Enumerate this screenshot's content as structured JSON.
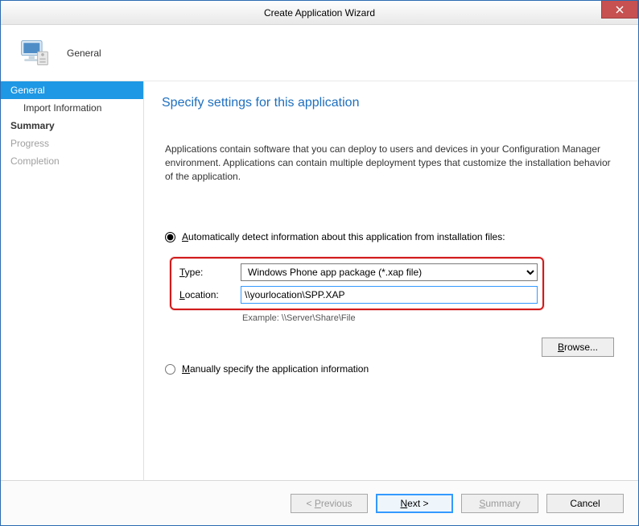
{
  "window": {
    "title": "Create Application Wizard"
  },
  "header": {
    "title": "General"
  },
  "sidebar": {
    "items": [
      {
        "label": "General",
        "selected": true,
        "bold": false,
        "sub": false,
        "disabled": false
      },
      {
        "label": "Import Information",
        "selected": false,
        "bold": false,
        "sub": true,
        "disabled": false
      },
      {
        "label": "Summary",
        "selected": false,
        "bold": true,
        "sub": false,
        "disabled": false
      },
      {
        "label": "Progress",
        "selected": false,
        "bold": false,
        "sub": false,
        "disabled": true
      },
      {
        "label": "Completion",
        "selected": false,
        "bold": false,
        "sub": false,
        "disabled": true
      }
    ]
  },
  "main": {
    "page_title": "Specify settings for this application",
    "description": "Applications contain software that you can deploy to users and devices in your Configuration Manager environment. Applications can contain multiple deployment types that customize the installation behavior of the application.",
    "auto_radio_label_pre": "A",
    "auto_radio_label_post": "utomatically detect information about this application from installation files:",
    "type_label_pre": "T",
    "type_label_post": "ype:",
    "type_value": "Windows Phone app package (*.xap file)",
    "location_label_pre": "L",
    "location_label_post": "ocation:",
    "location_value": "\\\\yourlocation\\SPP.XAP",
    "example_text": "Example: \\\\Server\\Share\\File",
    "browse_label_pre": "B",
    "browse_label_post": "rowse...",
    "manual_radio_label_pre": "M",
    "manual_radio_label_post": "anually specify the application information"
  },
  "footer": {
    "previous_pre": "< ",
    "previous_u": "P",
    "previous_post": "revious",
    "next_pre": "",
    "next_u": "N",
    "next_post": "ext >",
    "summary_u": "S",
    "summary_post": "ummary",
    "cancel": "Cancel"
  }
}
